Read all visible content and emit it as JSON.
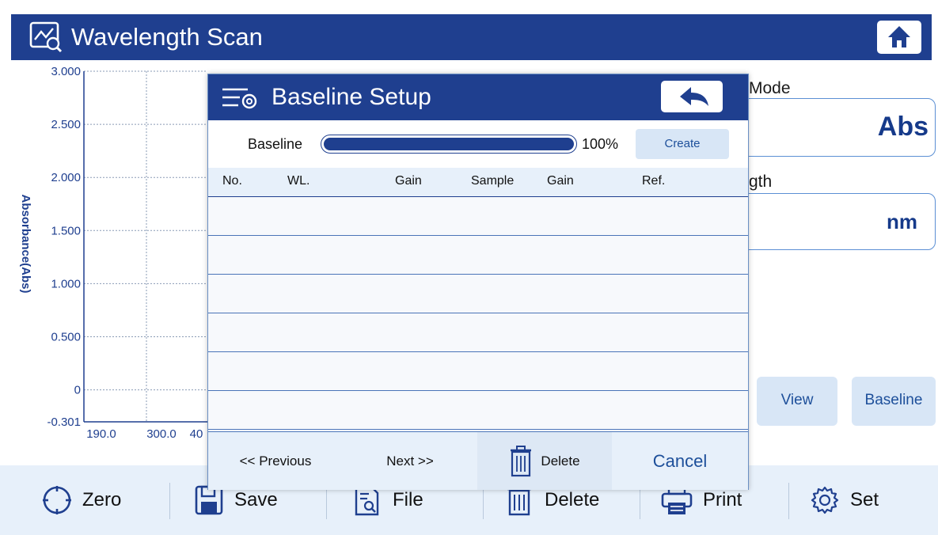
{
  "header": {
    "title": "Wavelength Scan",
    "icon": "chart-scan-icon",
    "home_icon": "home-icon"
  },
  "chart": {
    "ylabel": "Absorbance(Abs)",
    "y_ticks": [
      "3.000",
      "2.500",
      "2.000",
      "1.500",
      "1.000",
      "0.500",
      "0",
      "-0.301"
    ],
    "x_ticks": [
      "190.0",
      "300.0",
      "40"
    ]
  },
  "chart_data": {
    "type": "line",
    "ylabel": "Absorbance(Abs)",
    "ylim": [
      -0.301,
      3.0
    ],
    "y_ticks": [
      3.0,
      2.5,
      2.0,
      1.5,
      1.0,
      0.5,
      0,
      -0.301
    ],
    "x_ticks": [
      190.0,
      300.0
    ],
    "grid": true,
    "series": []
  },
  "side": {
    "mode_label": "Mode",
    "mode_value": "Abs",
    "wl_label": "gth",
    "wl_unit": "nm",
    "view_label": "View",
    "baseline_label": "Baseline"
  },
  "dialog": {
    "title": "Baseline Setup",
    "title_icon": "settings-list-icon",
    "back_icon": "back-arrow-icon",
    "baseline_label": "Baseline",
    "progress": 1.0,
    "progress_text": "100%",
    "create_label": "Create",
    "columns": [
      "No.",
      "WL.",
      "Gain",
      "Sample",
      "Gain",
      "Ref."
    ],
    "rows": [
      {},
      {},
      {},
      {},
      {},
      {}
    ],
    "footer": {
      "previous": "<< Previous",
      "next": "Next >>",
      "delete": "Delete",
      "cancel": "Cancel"
    }
  },
  "toolbar": {
    "zero": "Zero",
    "save": "Save",
    "file": "File",
    "delete": "Delete",
    "print": "Print",
    "set": "Set"
  },
  "colors": {
    "accent": "#1f3f8f",
    "panel": "#e7f0fa",
    "button": "#d8e6f6",
    "border": "#5b8fd4"
  }
}
